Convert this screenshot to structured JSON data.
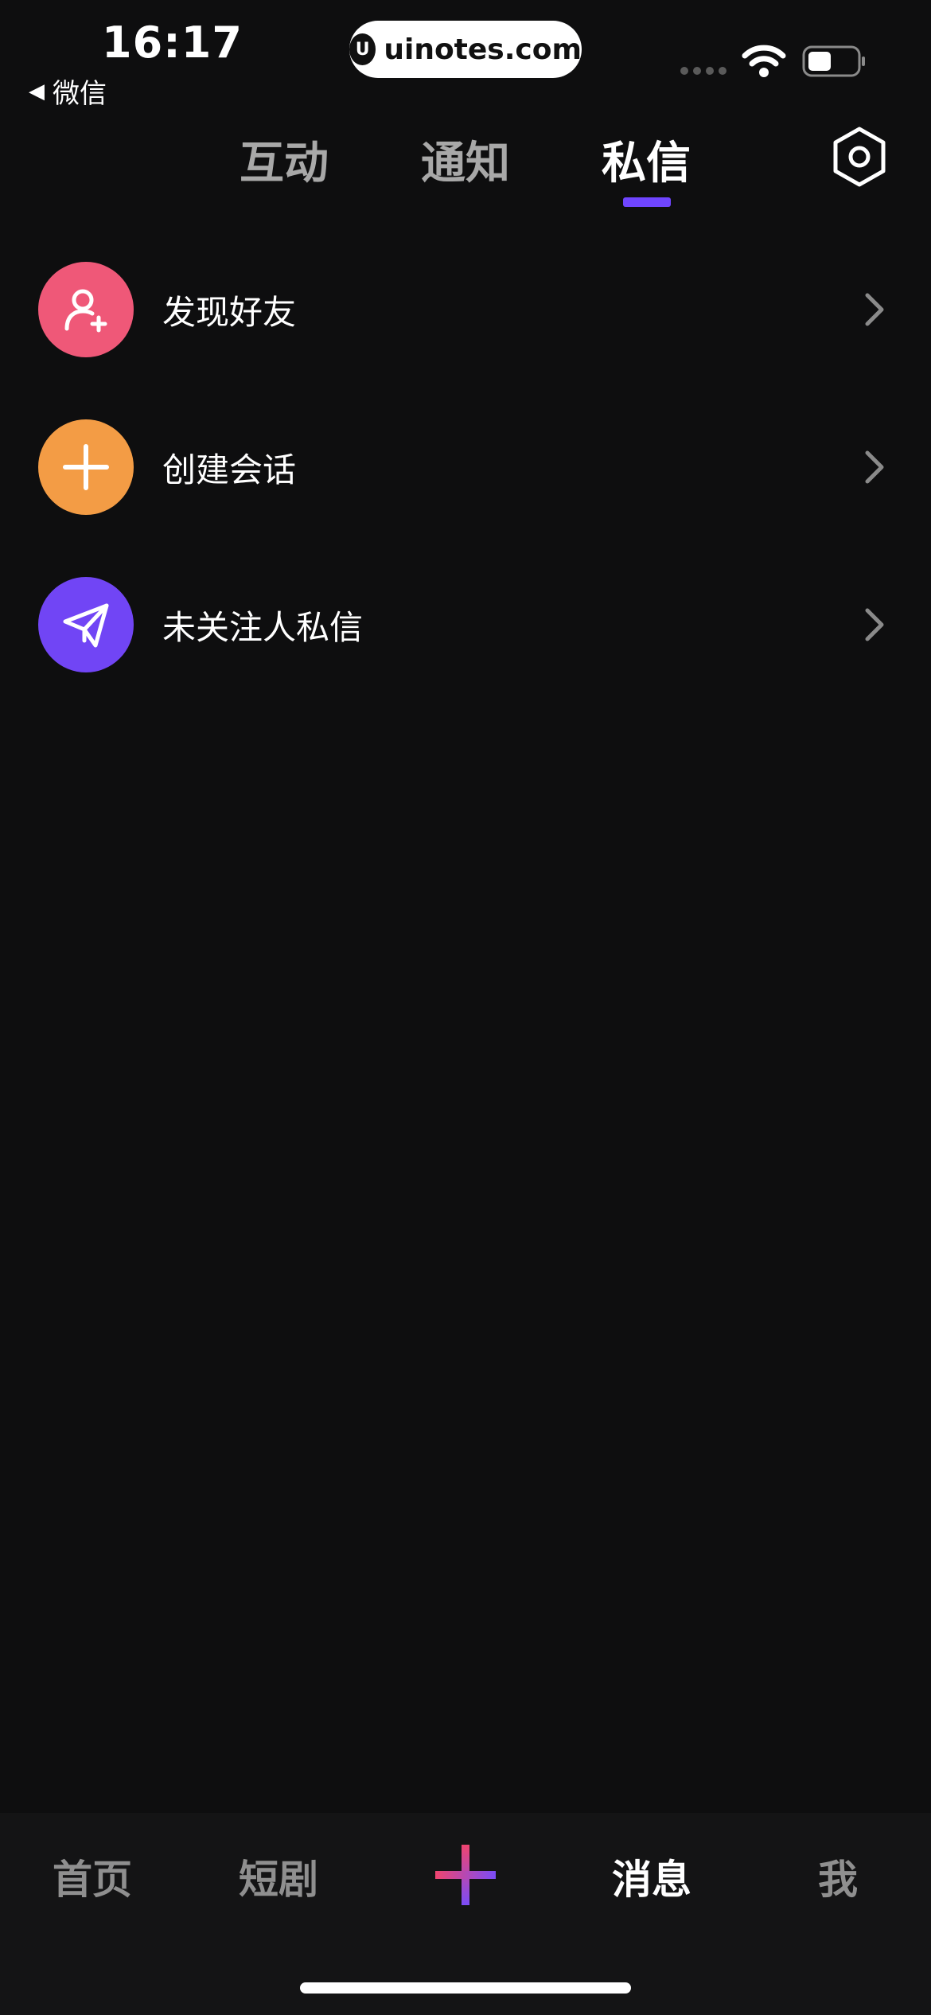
{
  "status_bar": {
    "time": "16:17",
    "back_app": "微信",
    "back_arrow": "◀",
    "url": "uinotes.com",
    "url_logo": "U"
  },
  "top_tabs": {
    "items": [
      {
        "label": "互动",
        "active": false
      },
      {
        "label": "通知",
        "active": false
      },
      {
        "label": "私信",
        "active": true
      }
    ],
    "accent": "#6f45ff",
    "settings_icon": "hexagon-gear-icon"
  },
  "actions": {
    "items": [
      {
        "label": "发现好友",
        "icon": "add-user-icon",
        "color": "#ef5878"
      },
      {
        "label": "创建会话",
        "icon": "plus-icon",
        "color": "#f39c45"
      },
      {
        "label": "未关注人私信",
        "icon": "paper-plane-icon",
        "color": "#7145f5"
      }
    ]
  },
  "bottom_nav": {
    "items": [
      {
        "label": "首页",
        "active": false
      },
      {
        "label": "短剧",
        "active": false
      },
      {
        "label": "消息",
        "active": true
      },
      {
        "label": "我",
        "active": false
      }
    ],
    "create_icon": "plus-create-icon",
    "create_colors": [
      "#f0456f",
      "#7b4cf7"
    ]
  }
}
